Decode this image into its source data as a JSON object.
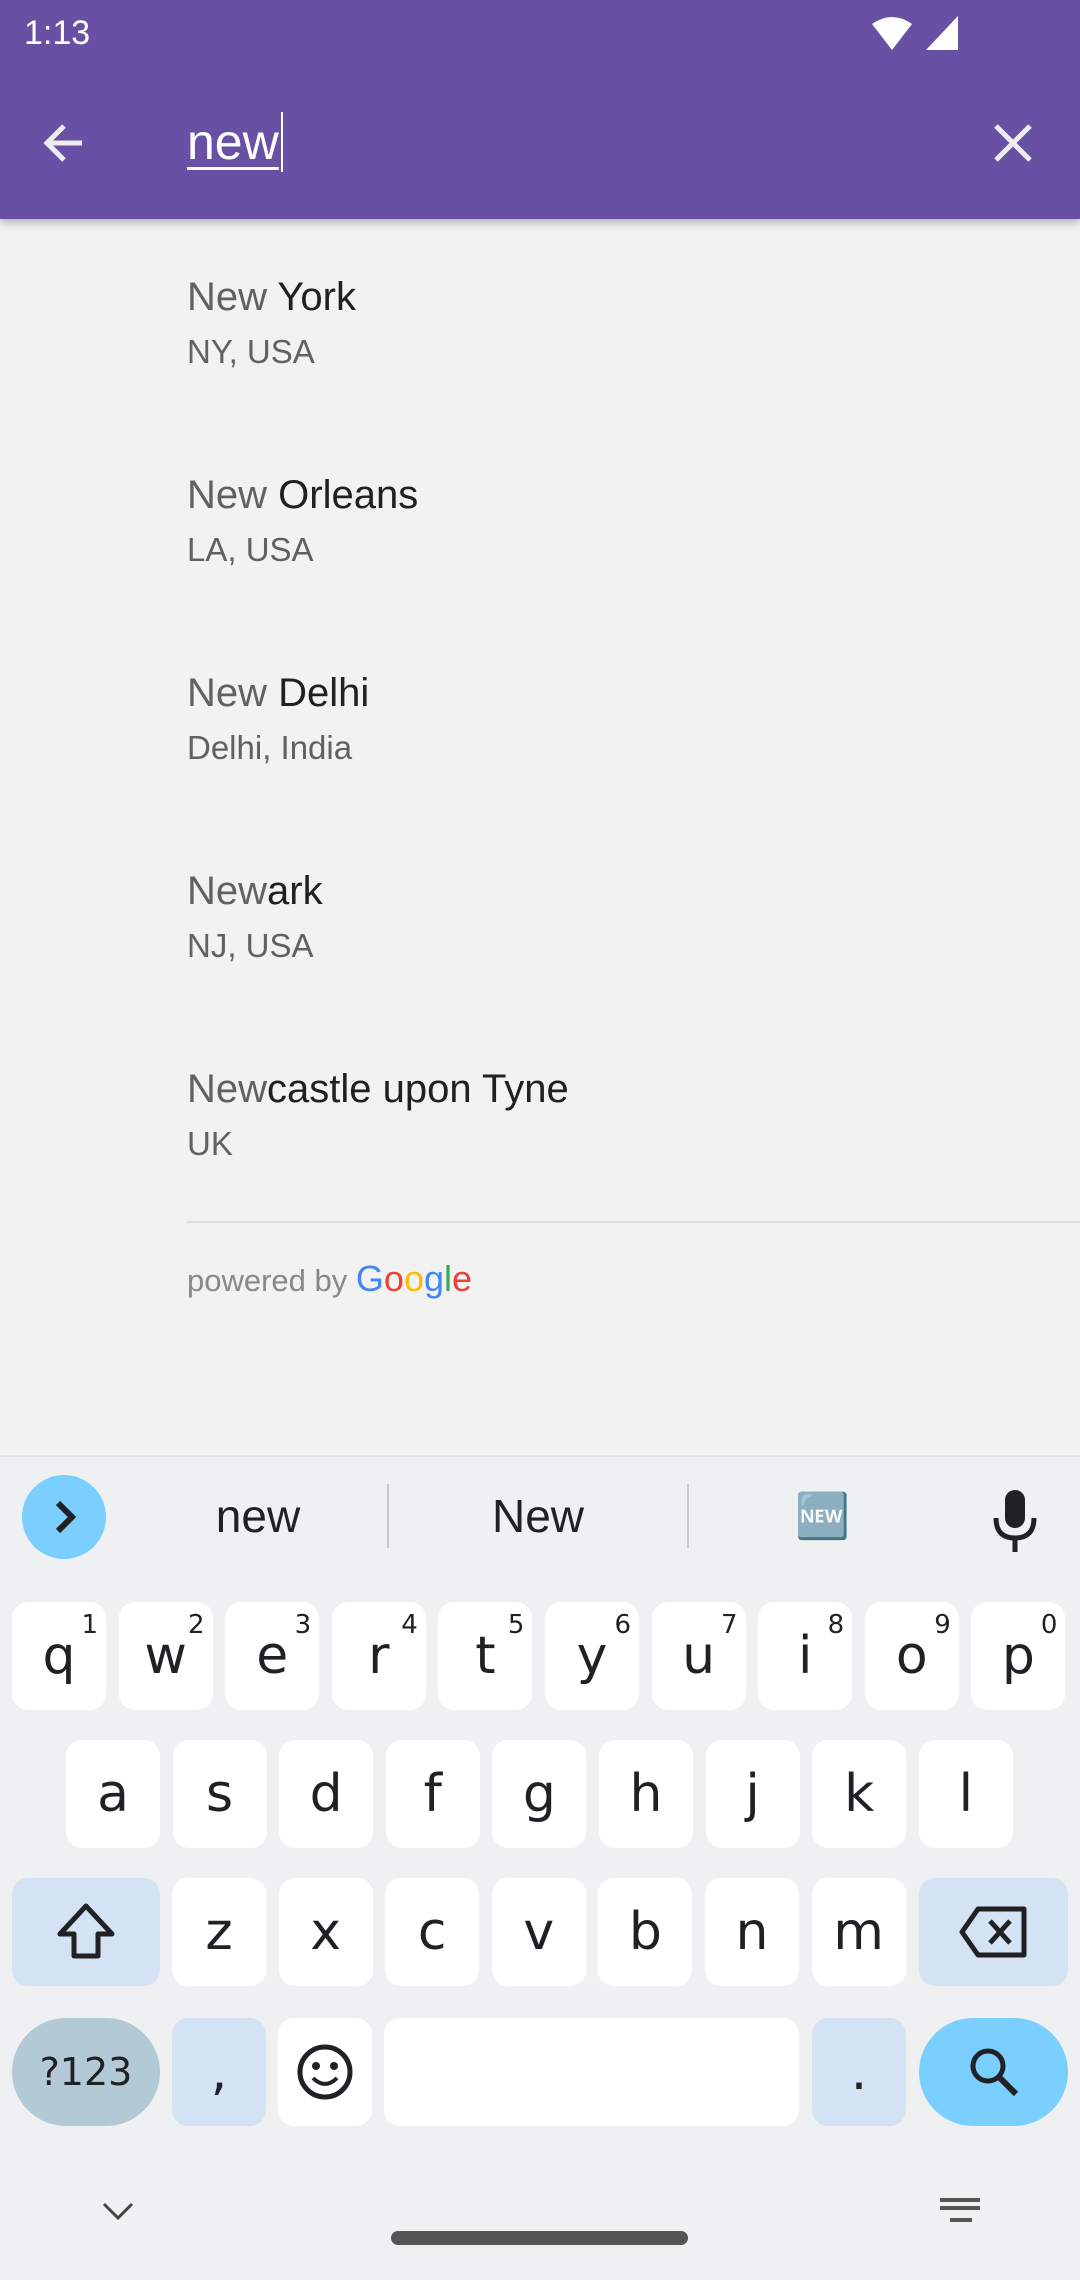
{
  "status_bar": {
    "time": "1:13"
  },
  "search": {
    "query": "new"
  },
  "results": [
    {
      "match": "New",
      "rest": " York",
      "subtitle": "NY, USA"
    },
    {
      "match": "New",
      "rest": " Orleans",
      "subtitle": "LA, USA"
    },
    {
      "match": "New",
      "rest": " Delhi",
      "subtitle": "Delhi, India"
    },
    {
      "match": "New",
      "rest": "ark",
      "subtitle": "NJ, USA"
    },
    {
      "match": "New",
      "rest": "castle upon Tyne",
      "subtitle": "UK"
    }
  ],
  "attribution": {
    "prefix": "powered by ",
    "brand": "Google"
  },
  "keyboard": {
    "suggestions": [
      "new",
      "New",
      "🆕"
    ],
    "row1": [
      [
        "q",
        "1"
      ],
      [
        "w",
        "2"
      ],
      [
        "e",
        "3"
      ],
      [
        "r",
        "4"
      ],
      [
        "t",
        "5"
      ],
      [
        "y",
        "6"
      ],
      [
        "u",
        "7"
      ],
      [
        "i",
        "8"
      ],
      [
        "o",
        "9"
      ],
      [
        "p",
        "0"
      ]
    ],
    "row2": [
      "a",
      "s",
      "d",
      "f",
      "g",
      "h",
      "j",
      "k",
      "l"
    ],
    "row3": [
      "z",
      "x",
      "c",
      "v",
      "b",
      "n",
      "m"
    ],
    "symbols_label": "?123",
    "comma": ",",
    "period": "."
  },
  "colors": {
    "app_bar": "#6851a5",
    "accent": "#7acfff"
  }
}
